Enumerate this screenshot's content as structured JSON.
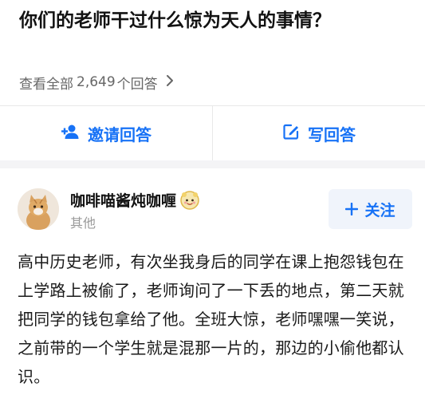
{
  "question": {
    "title": "你们的老师干过什么惊为天人的事情？"
  },
  "answers_link": {
    "prefix": "查看全部",
    "count": "2,649",
    "suffix": "个回答",
    "icon": "chevron-right-icon"
  },
  "actions": {
    "invite": {
      "label": "邀请回答",
      "icon": "add-user-icon"
    },
    "write": {
      "label": "写回答",
      "icon": "edit-icon"
    }
  },
  "author": {
    "name": "咖啡喵酱炖咖喱",
    "subtitle": "其他",
    "badge_icon": "cute-badge-icon",
    "avatar_icon": "cat-avatar-icon"
  },
  "follow": {
    "label": "关注",
    "icon": "plus-icon"
  },
  "answer": {
    "text": "高中历史老师，有次坐我身后的同学在课上抱怨钱包在上学路上被偷了，老师询问了一下丢的地点，第二天就把同学的钱包拿给了他。全班大惊，老师嘿嘿一笑说，之前带的一个学生就是混那一片的，那边的小偷他都认识。"
  },
  "colors": {
    "accent": "#1772f6",
    "muted": "#999999",
    "divider": "#e8e8e8"
  }
}
